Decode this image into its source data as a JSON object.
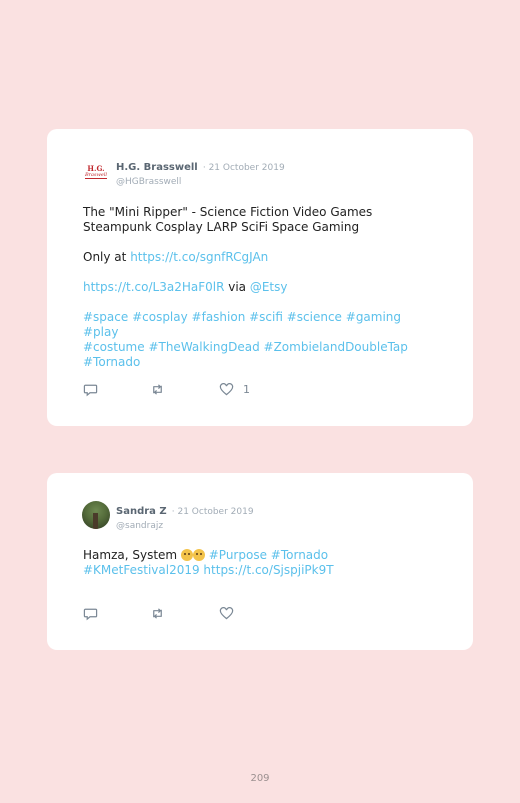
{
  "tweets": [
    {
      "avatar": {
        "line1": "H.G.",
        "line2": "Braswell"
      },
      "name": "H.G. Brasswell",
      "date": "21 October 2019",
      "handle": "@HGBrasswell",
      "line1": "The \"Mini Ripper\" - Science Fiction Video Games",
      "line2": "Steampunk Cosplay LARP SciFi Space Gaming",
      "only_at": "Only at ",
      "link1": "https://t.co/sgnfRCgJAn",
      "link2": "https://t.co/L3a2HaF0lR",
      "via": " via ",
      "mention": "@Etsy",
      "hashtags_line1": "#space #cosplay #fashion #scifi #science #gaming #play",
      "hashtags_line2": "#costume #TheWalkingDead #ZombielandDoubleTap",
      "hashtags_line3": "#Tornado",
      "like_count": "1"
    },
    {
      "name": "Sandra Z",
      "date": "21 October 2019",
      "handle": "@sandrajz",
      "text_prefix": "Hamza, System ",
      "hashtags_line1": "#Purpose #Tornado",
      "hashtags_line2": "#KMetFestival2019 https://t.co/SjspjiPk9T"
    }
  ],
  "page_number": "209",
  "icons": {
    "reply": "reply-icon",
    "retweet": "retweet-icon",
    "like": "heart-icon"
  },
  "colors": {
    "link": "#5bc0eb",
    "background": "#fae1e1",
    "icon": "#7b8895"
  }
}
